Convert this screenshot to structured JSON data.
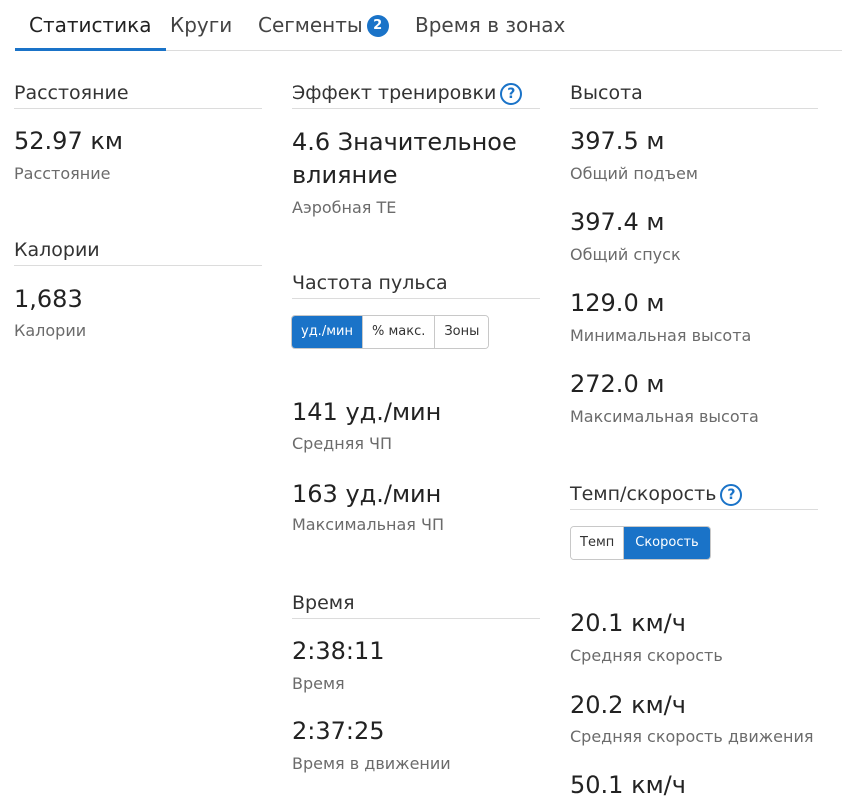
{
  "tabs": [
    {
      "label": "Статистика"
    },
    {
      "label": "Круги"
    },
    {
      "label": "Сегменты",
      "badge": "2"
    },
    {
      "label": "Время в зонах"
    }
  ],
  "colors": {
    "accent": "#1a73c8"
  },
  "distance": {
    "title": "Расстояние",
    "value": "52.97 км",
    "label": "Расстояние"
  },
  "calories": {
    "title": "Калории",
    "value": "1,683",
    "label": "Калории"
  },
  "training_effect": {
    "title": "Эффект тренировки",
    "value": "4.6 Значительное влияние",
    "label": "Аэробная TE"
  },
  "heart_rate": {
    "title": "Частота пульса",
    "toggle": [
      "уд./мин",
      "% макс.",
      "Зоны"
    ],
    "avg_value": "141 уд./мин",
    "avg_label": "Средняя ЧП",
    "max_value": "163 уд./мин",
    "max_label": "Максимальная ЧП"
  },
  "time": {
    "title": "Время",
    "total_value": "2:38:11",
    "total_label": "Время",
    "moving_value": "2:37:25",
    "moving_label": "Время в движении"
  },
  "elevation": {
    "title": "Высота",
    "gain_value": "397.5 м",
    "gain_label": "Общий подъем",
    "loss_value": "397.4 м",
    "loss_label": "Общий спуск",
    "min_value": "129.0 м",
    "min_label": "Минимальная высота",
    "max_value": "272.0 м",
    "max_label": "Максимальная высота"
  },
  "pace_speed": {
    "title": "Темп/скорость",
    "toggle": [
      "Темп",
      "Скорость"
    ],
    "avg_value": "20.1 км/ч",
    "avg_label": "Средняя скорость",
    "avg_moving_value": "20.2 км/ч",
    "avg_moving_label": "Средняя скорость движения",
    "max_value": "50.1 км/ч"
  }
}
